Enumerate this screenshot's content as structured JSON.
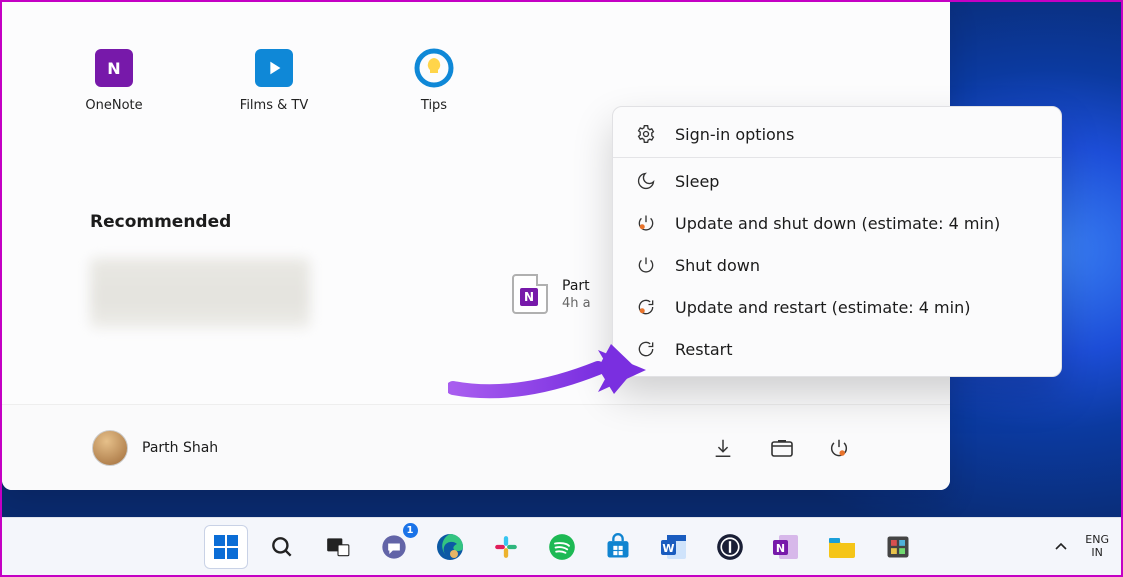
{
  "pinned": [
    {
      "name": "OneNote",
      "color": "#7719aa",
      "letter": "N"
    },
    {
      "name": "Films & TV",
      "color": "#0f88d7",
      "letter": "▶"
    },
    {
      "name": "Tips",
      "color": "#0f88d7",
      "letter": "💡"
    }
  ],
  "recommended_title": "Recommended",
  "recommended_item": {
    "line1": "Part",
    "line2": "4h a"
  },
  "user_name": "Parth Shah",
  "power_menu": {
    "signin": "Sign-in options",
    "sleep": "Sleep",
    "update_shutdown": "Update and shut down (estimate: 4 min)",
    "shutdown": "Shut down",
    "update_restart": "Update and restart (estimate: 4 min)",
    "restart": "Restart"
  },
  "taskbar": {
    "apps": [
      {
        "name": "start",
        "letter": ""
      },
      {
        "name": "search",
        "letter": ""
      },
      {
        "name": "task-view",
        "letter": ""
      },
      {
        "name": "chat",
        "letter": "",
        "badge": "1"
      },
      {
        "name": "edge",
        "letter": ""
      },
      {
        "name": "slack",
        "letter": ""
      },
      {
        "name": "spotify",
        "letter": ""
      },
      {
        "name": "store",
        "letter": ""
      },
      {
        "name": "word",
        "letter": "W"
      },
      {
        "name": "onepassword",
        "letter": ""
      },
      {
        "name": "onenote",
        "letter": "N"
      },
      {
        "name": "explorer",
        "letter": ""
      },
      {
        "name": "powertoys",
        "letter": ""
      }
    ],
    "lang_top": "ENG",
    "lang_bottom": "IN"
  }
}
